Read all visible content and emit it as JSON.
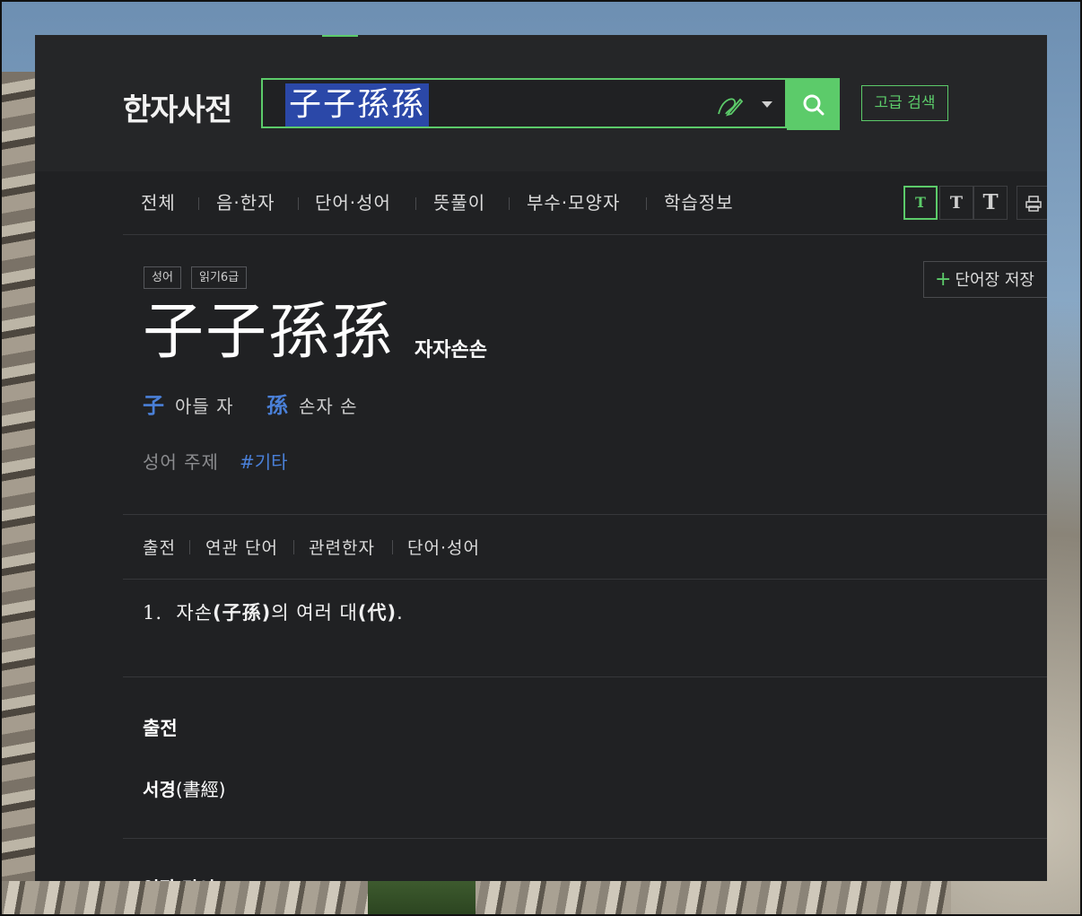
{
  "app": {
    "logo": "한자사전"
  },
  "search": {
    "query": "子子孫孫",
    "button_icon": "search-icon",
    "handwrite_icon": "pen-icon",
    "advanced": "고급 검색"
  },
  "tabs": [
    "전체",
    "음·한자",
    "단어·성어",
    "뜻풀이",
    "부수·모양자",
    "학습정보"
  ],
  "text_size": [
    "T",
    "T",
    "T"
  ],
  "entry": {
    "badges": [
      "성어",
      "읽기6급"
    ],
    "save": "단어장 저장",
    "title": "子子孫孫",
    "reading": "자자손손",
    "chars": [
      {
        "hanja": "子",
        "meaning": "아들 자"
      },
      {
        "hanja": "孫",
        "meaning": "손자 손"
      }
    ],
    "theme_label": "성어 주제",
    "theme_tag": "#기타"
  },
  "subtabs": [
    "출전",
    "연관 단어",
    "관련한자",
    "단어·성어"
  ],
  "definition": {
    "num": "1.",
    "pre": "자손",
    "paren1": "(子孫)",
    "mid": "의 여러 대",
    "paren2": "(代)",
    "end": "."
  },
  "source_section": {
    "title": "출전",
    "name": "서경",
    "hanja": "(書經)"
  },
  "next_section": {
    "title": "연관 단어"
  },
  "colors": {
    "accent": "#5ccb6a",
    "link": "#4a80d8",
    "bg": "#202123"
  }
}
